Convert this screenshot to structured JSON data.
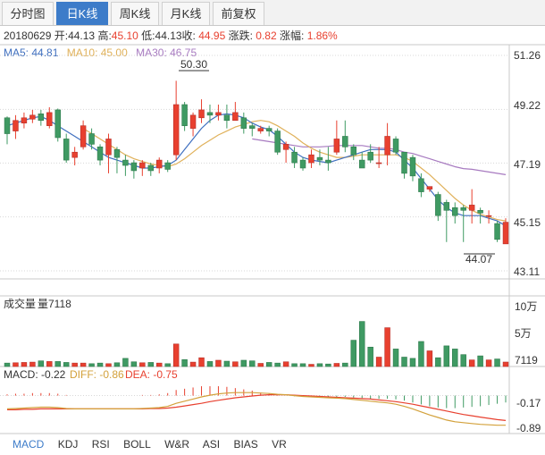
{
  "tabs": [
    {
      "label": "分时图",
      "active": false
    },
    {
      "label": "日K线",
      "active": true
    },
    {
      "label": "周K线",
      "active": false
    },
    {
      "label": "月K线",
      "active": false
    },
    {
      "label": "前复权",
      "active": false
    }
  ],
  "info": {
    "date": "20180629",
    "open_label": "开:",
    "open": "44.13",
    "high_label": "高:",
    "high": "45.10",
    "low_label": "低:",
    "low": "44.13",
    "close_label": "收:",
    "close": "44.95",
    "change_label": "涨跌:",
    "change": "0.82",
    "pct_label": "涨幅:",
    "pct": "1.86%"
  },
  "ma_legend": {
    "ma5": "MA5: 44.81",
    "ma10": "MA10: 45.00",
    "ma30": "MA30: 46.75"
  },
  "price_axis": [
    "51.26",
    "49.22",
    "47.19",
    "45.15",
    "43.11"
  ],
  "annotations": {
    "high": "50.30",
    "low": "44.07"
  },
  "volume": {
    "label": "成交量",
    "value_text": "量7118",
    "axis": [
      "10万",
      "5万",
      "7119"
    ]
  },
  "macd": {
    "macd_text": "MACD: -0.22",
    "diff_text": "DIFF: -0.86",
    "dea_text": "DEA: -0.75",
    "axis": [
      "-0.17",
      "-0.89"
    ]
  },
  "indicator_tabs": [
    "MACD",
    "KDJ",
    "RSI",
    "BOLL",
    "W&R",
    "ASI",
    "BIAS",
    "VR"
  ],
  "colors": {
    "up": "#e8402f",
    "down": "#3f9a63",
    "ma5": "#3f6fbf",
    "ma10": "#e0b15a",
    "ma30": "#a77ac0",
    "accent": "#3d7cc9",
    "grid": "#d8d8d8"
  },
  "chart_data": [
    {
      "type": "candlestick",
      "ylim": [
        43.11,
        51.26
      ],
      "yticks": [
        51.26,
        49.22,
        47.19,
        45.15,
        43.11
      ],
      "candles": [
        [
          48.9,
          48.3,
          48.95,
          47.9
        ],
        [
          48.4,
          48.8,
          49.0,
          48.1
        ],
        [
          48.7,
          48.9,
          49.1,
          48.5
        ],
        [
          48.85,
          49.0,
          49.2,
          48.7
        ],
        [
          49.05,
          48.8,
          49.2,
          48.6
        ],
        [
          48.6,
          49.1,
          49.3,
          48.5
        ],
        [
          49.2,
          48.15,
          49.25,
          48.0
        ],
        [
          48.1,
          47.3,
          48.3,
          47.2
        ],
        [
          47.4,
          47.6,
          47.8,
          47.1
        ],
        [
          47.8,
          48.6,
          48.8,
          47.7
        ],
        [
          48.3,
          47.9,
          48.5,
          47.7
        ],
        [
          47.8,
          47.3,
          47.9,
          47.1
        ],
        [
          47.5,
          48.1,
          48.3,
          46.8
        ],
        [
          47.7,
          47.4,
          47.8,
          46.8
        ],
        [
          47.3,
          47.1,
          47.5,
          46.7
        ],
        [
          47.2,
          46.9,
          47.3,
          46.6
        ],
        [
          47.0,
          47.2,
          47.3,
          46.7
        ],
        [
          47.1,
          46.9,
          47.2,
          46.7
        ],
        [
          47.0,
          47.3,
          47.4,
          46.8
        ],
        [
          47.2,
          46.95,
          47.3,
          46.85
        ],
        [
          47.5,
          49.4,
          50.3,
          47.3
        ],
        [
          49.4,
          48.6,
          49.5,
          48.4
        ],
        [
          48.5,
          49.0,
          49.1,
          48.2
        ],
        [
          48.9,
          49.2,
          49.6,
          48.7
        ],
        [
          49.1,
          49.0,
          49.4,
          48.7
        ],
        [
          49.0,
          49.1,
          49.4,
          48.8
        ],
        [
          49.0,
          48.8,
          49.4,
          48.5
        ],
        [
          48.8,
          49.1,
          49.5,
          48.8
        ],
        [
          48.9,
          48.5,
          49.1,
          48.3
        ],
        [
          48.6,
          48.5,
          48.7,
          48.2
        ],
        [
          48.4,
          48.5,
          48.6,
          48.3
        ],
        [
          48.5,
          48.4,
          48.6,
          48.2
        ],
        [
          48.4,
          47.6,
          48.5,
          47.5
        ],
        [
          47.7,
          47.9,
          48.0,
          47.2
        ],
        [
          47.6,
          47.2,
          47.8,
          47.0
        ],
        [
          47.3,
          47.0,
          47.4,
          46.9
        ],
        [
          47.2,
          47.5,
          47.7,
          47.0
        ],
        [
          47.4,
          47.3,
          47.7,
          47.1
        ],
        [
          47.3,
          47.2,
          47.8,
          46.9
        ],
        [
          47.6,
          48.1,
          48.8,
          47.5
        ],
        [
          48.2,
          47.8,
          48.8,
          47.6
        ],
        [
          47.8,
          47.5,
          47.9,
          47.3
        ],
        [
          47.3,
          47.0,
          47.6,
          47.3
        ],
        [
          47.6,
          47.3,
          47.9,
          47.2
        ],
        [
          47.2,
          47.2,
          47.8,
          47.0
        ],
        [
          47.5,
          48.2,
          48.7,
          47.1
        ],
        [
          48.1,
          47.6,
          48.2,
          47.5
        ],
        [
          47.6,
          46.8,
          47.6,
          46.6
        ],
        [
          47.4,
          46.7,
          47.5,
          46.5
        ],
        [
          46.6,
          46.1,
          46.8,
          45.9
        ],
        [
          46.2,
          46.3,
          46.3,
          46.1
        ],
        [
          46.0,
          45.2,
          46.1,
          45.0
        ],
        [
          45.7,
          45.4,
          45.8,
          44.2
        ],
        [
          45.5,
          45.2,
          45.7,
          44.9
        ],
        [
          45.5,
          45.4,
          45.6,
          44.2
        ],
        [
          45.4,
          45.6,
          46.2,
          44.9
        ],
        [
          45.4,
          45.3,
          45.5,
          44.9
        ],
        [
          45.2,
          45.2,
          45.4,
          44.9
        ],
        [
          44.9,
          44.3,
          45.0,
          44.2
        ],
        [
          44.13,
          44.95,
          45.1,
          44.13
        ]
      ],
      "ma5": [
        48.6,
        48.7,
        48.8,
        48.9,
        48.95,
        48.8,
        48.6,
        48.4,
        48.2,
        48.0,
        47.8,
        47.6,
        47.4,
        47.3,
        47.2,
        47.1,
        47.0,
        47.0,
        47.05,
        47.1,
        47.3,
        47.7,
        48.1,
        48.5,
        48.8,
        49.0,
        49.05,
        49.0,
        48.9,
        48.7,
        48.55,
        48.45,
        48.2,
        47.9,
        47.6,
        47.4,
        47.3,
        47.25,
        47.2,
        47.3,
        47.4,
        47.5,
        47.6,
        47.7,
        47.7,
        47.7,
        47.6,
        47.3,
        47.0,
        46.6,
        46.2,
        45.8,
        45.5,
        45.3,
        45.2,
        45.2,
        45.2,
        45.1,
        45.0,
        44.81
      ],
      "ma10": [
        null,
        null,
        null,
        null,
        null,
        null,
        null,
        null,
        null,
        48.5,
        48.3,
        48.1,
        47.9,
        47.7,
        47.5,
        47.35,
        47.25,
        47.15,
        47.1,
        47.05,
        47.15,
        47.35,
        47.6,
        47.85,
        48.05,
        48.25,
        48.4,
        48.55,
        48.65,
        48.75,
        48.8,
        48.75,
        48.6,
        48.4,
        48.2,
        47.95,
        47.75,
        47.6,
        47.5,
        47.4,
        47.4,
        47.45,
        47.5,
        47.5,
        47.5,
        47.5,
        47.5,
        47.4,
        47.25,
        47.0,
        46.75,
        46.45,
        46.15,
        45.85,
        45.6,
        45.4,
        45.25,
        45.15,
        45.05,
        45.0
      ],
      "ma30": [
        null,
        null,
        null,
        null,
        null,
        null,
        null,
        null,
        null,
        null,
        null,
        null,
        null,
        null,
        null,
        null,
        null,
        null,
        null,
        null,
        null,
        null,
        null,
        null,
        null,
        null,
        null,
        null,
        null,
        48.1,
        48.05,
        48.0,
        47.95,
        47.9,
        47.85,
        47.8,
        47.8,
        47.8,
        47.82,
        47.85,
        47.85,
        47.85,
        47.85,
        47.8,
        47.75,
        47.75,
        47.7,
        47.6,
        47.55,
        47.45,
        47.35,
        47.25,
        47.15,
        47.05,
        46.98,
        46.95,
        46.9,
        46.85,
        46.8,
        46.75
      ]
    },
    {
      "type": "bar",
      "title": "成交量",
      "ylim": [
        0,
        100000
      ],
      "values": [
        5500,
        6000,
        6500,
        7000,
        9000,
        8000,
        8000,
        6500,
        5500,
        5500,
        4500,
        5500,
        4500,
        6000,
        13000,
        7500,
        6000,
        6500,
        5500,
        4500,
        36000,
        11000,
        7000,
        14000,
        8000,
        10000,
        8500,
        7500,
        10000,
        9000,
        5000,
        6500,
        5500,
        7500,
        4500,
        4500,
        3500,
        4500,
        4000,
        5000,
        5500,
        42000,
        72000,
        31000,
        15000,
        62000,
        28000,
        15000,
        13000,
        40000,
        25000,
        14000,
        33000,
        28000,
        19000,
        10500,
        17000,
        10500,
        12000,
        7118
      ]
    },
    {
      "type": "line",
      "title": "MACD",
      "ylim": [
        -0.95,
        0.05
      ],
      "diff": [
        -0.48,
        -0.47,
        -0.46,
        -0.45,
        -0.44,
        -0.44,
        -0.45,
        -0.47,
        -0.48,
        -0.48,
        -0.48,
        -0.48,
        -0.48,
        -0.48,
        -0.48,
        -0.48,
        -0.47,
        -0.46,
        -0.45,
        -0.42,
        -0.35,
        -0.3,
        -0.25,
        -0.2,
        -0.16,
        -0.13,
        -0.11,
        -0.1,
        -0.1,
        -0.1,
        -0.11,
        -0.12,
        -0.14,
        -0.15,
        -0.17,
        -0.19,
        -0.2,
        -0.21,
        -0.22,
        -0.23,
        -0.24,
        -0.26,
        -0.28,
        -0.3,
        -0.32,
        -0.34,
        -0.37,
        -0.42,
        -0.48,
        -0.55,
        -0.62,
        -0.68,
        -0.74,
        -0.78,
        -0.8,
        -0.82,
        -0.84,
        -0.85,
        -0.86,
        -0.86
      ],
      "dea": [
        -0.5,
        -0.5,
        -0.49,
        -0.49,
        -0.48,
        -0.48,
        -0.48,
        -0.48,
        -0.48,
        -0.48,
        -0.48,
        -0.48,
        -0.48,
        -0.48,
        -0.48,
        -0.48,
        -0.48,
        -0.47,
        -0.47,
        -0.46,
        -0.44,
        -0.41,
        -0.38,
        -0.35,
        -0.31,
        -0.28,
        -0.25,
        -0.22,
        -0.2,
        -0.18,
        -0.16,
        -0.15,
        -0.15,
        -0.15,
        -0.16,
        -0.17,
        -0.18,
        -0.19,
        -0.2,
        -0.21,
        -0.22,
        -0.23,
        -0.24,
        -0.25,
        -0.27,
        -0.29,
        -0.31,
        -0.34,
        -0.37,
        -0.41,
        -0.45,
        -0.49,
        -0.53,
        -0.57,
        -0.61,
        -0.64,
        -0.67,
        -0.7,
        -0.73,
        -0.75
      ]
    }
  ]
}
